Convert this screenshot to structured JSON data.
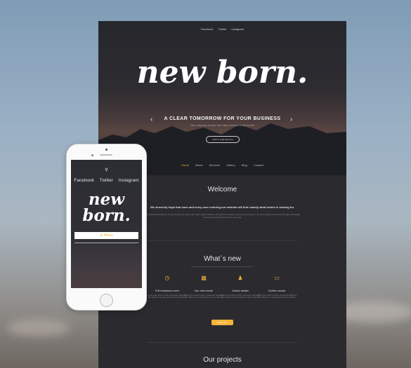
{
  "desktop": {
    "topnav": [
      "Facebook",
      "Twitter",
      "Instagram"
    ],
    "logo": "new born.",
    "hero": {
      "tagline": "A CLEAR TOMORROW FOR YOUR BUSINESS",
      "subtitle": "Our company is your one step solution for all needs",
      "button": "Click to read about us"
    },
    "mainnav": [
      "Home",
      "About",
      "Services",
      "Gallery",
      "Blog",
      "Contact"
    ],
    "welcome": {
      "title": "Welcome",
      "bold": "We sincerely hope that each and every user entering our website will find exactly what he/she is looking for.",
      "text": "With advanced features of a fresh and new sleek, fast, high quality website, you will find it easier to grow your business, run and market your brand and take advantage of every opportunity that comes your way."
    },
    "whatsnew": {
      "title": "What`s new",
      "features": [
        {
          "icon": "clock-icon",
          "title": "Full business cover",
          "text": "Lorem ipsum dolor sit amet, consectetur adipiscing elit. Vivamus non velit sed lorem rutrum eleifend."
        },
        {
          "icon": "book-icon",
          "title": "Our new home",
          "text": "Lorem ipsum dolor sit amet, consectetur adipiscing elit. Vivamus non velit sed lorem rutrum eleifend."
        },
        {
          "icon": "person-icon",
          "title": "Career ladder",
          "text": "Lorem ipsum dolor sit amet, consectetur adipiscing elit. Vivamus non velit sed lorem rutrum eleifend."
        },
        {
          "icon": "monitor-icon",
          "title": "Online course",
          "text": "Lorem ipsum dolor sit amet, consectetur adipiscing elit. Vivamus non velit sed lorem rutrum eleifend."
        }
      ],
      "button": "Read more"
    },
    "projects": {
      "title": "Our projects"
    }
  },
  "phone": {
    "social": [
      "Facebook",
      "Twitter",
      "Instagram"
    ],
    "logo_line1": "new",
    "logo_line2": "born.",
    "menu": "Menu"
  },
  "colors": {
    "accent": "#f5b43a",
    "page_bg": "#2b2b2f"
  }
}
